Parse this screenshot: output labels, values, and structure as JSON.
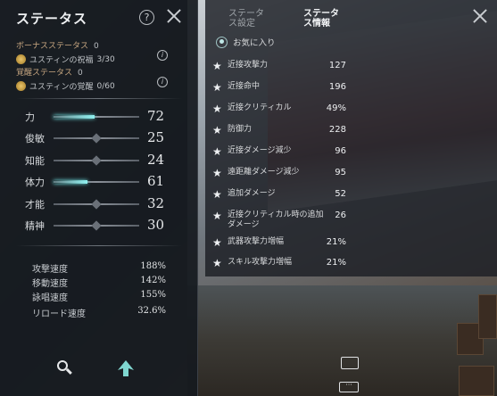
{
  "left_panel": {
    "title": "ステータス",
    "bonus": {
      "bonus_label": "ボーナスステータス",
      "bonus_count": "0",
      "blessing_label": "ユスティンの祝福",
      "blessing_value": "3/30",
      "awaken_label": "覚醒ステータス",
      "awaken_count": "0",
      "awakening_label": "ユスティンの覚醒",
      "awakening_value": "0/60"
    },
    "stats": [
      {
        "label": "力",
        "value": "72"
      },
      {
        "label": "俊敏",
        "value": "25"
      },
      {
        "label": "知能",
        "value": "24"
      },
      {
        "label": "体力",
        "value": "61"
      },
      {
        "label": "才能",
        "value": "32"
      },
      {
        "label": "精神",
        "value": "30"
      }
    ],
    "speeds": [
      {
        "label": "攻撃速度",
        "value": "188%"
      },
      {
        "label": "移動速度",
        "value": "142%"
      },
      {
        "label": "詠唱速度",
        "value": "155%"
      },
      {
        "label": "リロード速度",
        "value": "32.6%"
      }
    ]
  },
  "right_panel": {
    "tabs": [
      {
        "label": "ステータス設定",
        "active": false
      },
      {
        "label": "ステータス情報",
        "active": true
      }
    ],
    "favorite_label": "お気に入り",
    "details": [
      {
        "label": "近接攻撃力",
        "value": "127"
      },
      {
        "label": "近接命中",
        "value": "196"
      },
      {
        "label": "近接クリティカル",
        "value": "49%"
      },
      {
        "label": "防御力",
        "value": "228"
      },
      {
        "label": "近接ダメージ減少",
        "value": "96"
      },
      {
        "label": "遠距離ダメージ減少",
        "value": "95"
      },
      {
        "label": "追加ダメージ",
        "value": "52"
      },
      {
        "label": "近接クリティカル時の追加ダメージ",
        "value": "26"
      },
      {
        "label": "武器攻撃力増幅",
        "value": "21%"
      },
      {
        "label": "スキル攻撃力増幅",
        "value": "21%"
      }
    ]
  },
  "colors": {
    "accent_cyan": "#8ff0ef",
    "bonus_gold": "#c9a882",
    "panel_bg": "#161a1f"
  }
}
